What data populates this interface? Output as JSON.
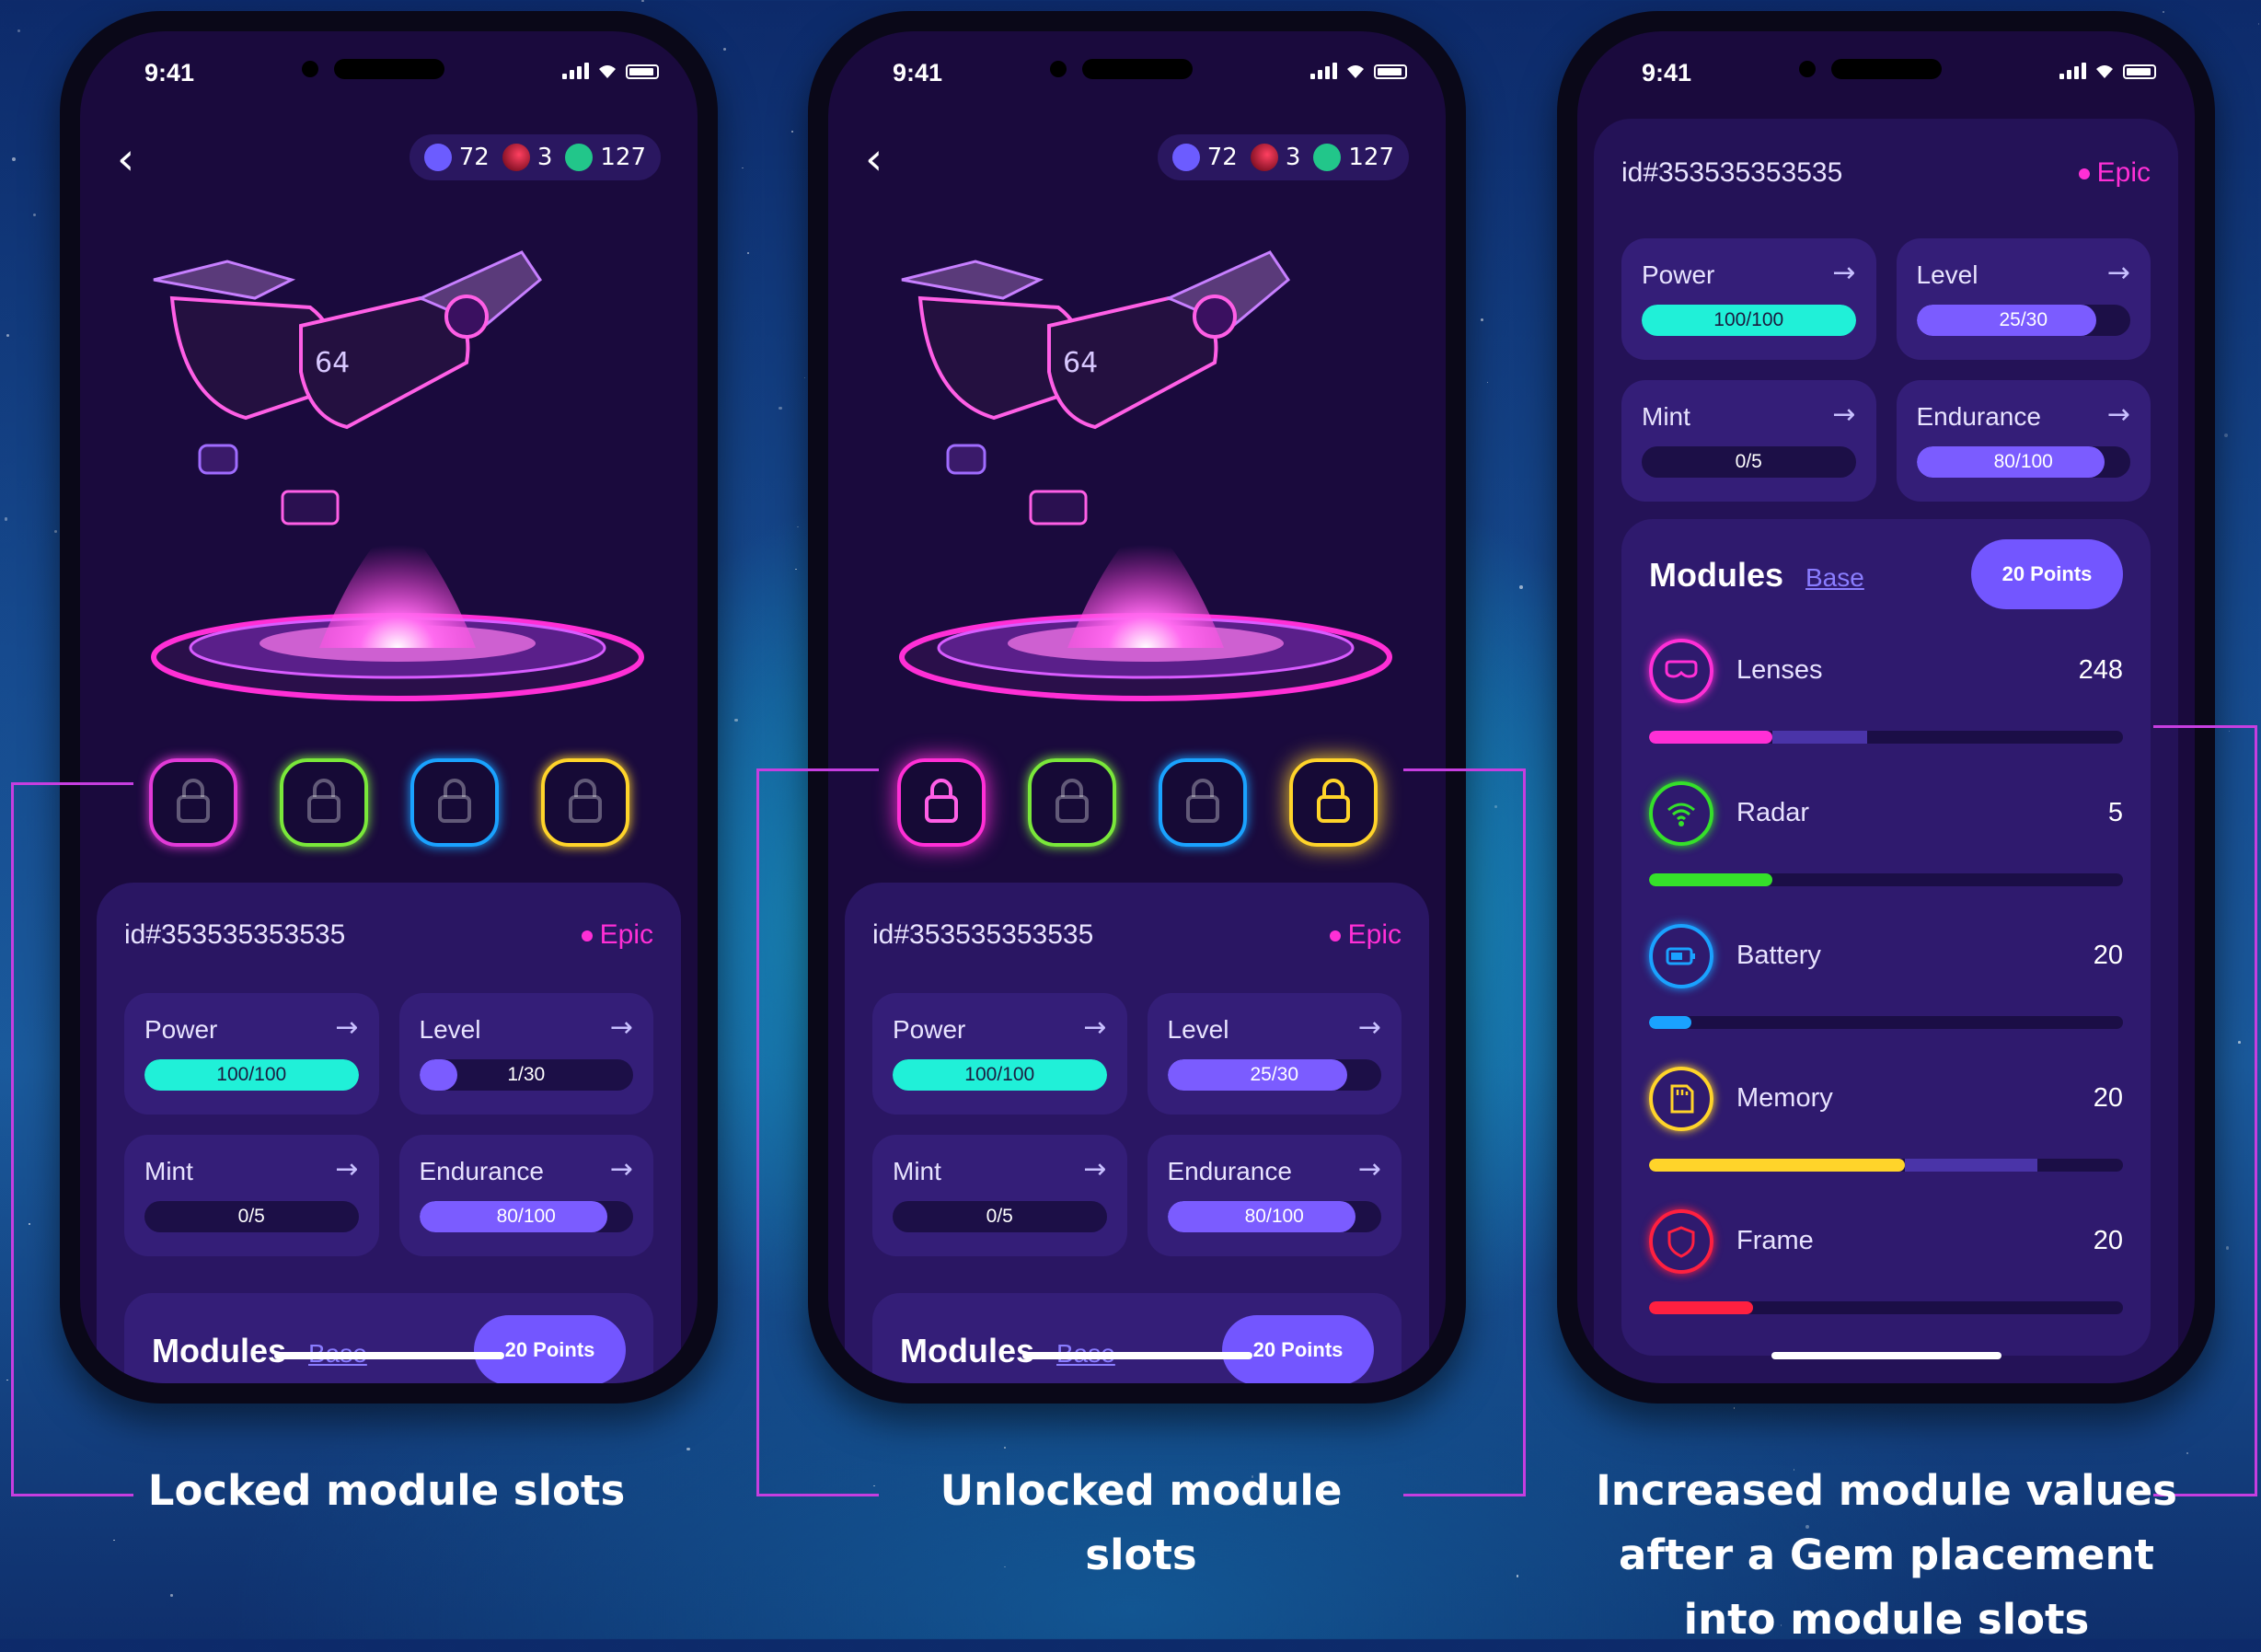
{
  "status": {
    "time": "9:41"
  },
  "currency": [
    {
      "value": "72",
      "color": "#6c5cff"
    },
    {
      "value": "3",
      "color": "#ff2040"
    },
    {
      "value": "127",
      "color": "#22c68a"
    }
  ],
  "card": {
    "id": "id#353535353535",
    "rarity": "Epic"
  },
  "phone1": {
    "stats": [
      {
        "label": "Power",
        "value": "100/100",
        "fill": 1.0,
        "color": "#20f0d8"
      },
      {
        "label": "Level",
        "value": "1/30",
        "fill": 0.18,
        "color": "#7b5cff"
      },
      {
        "label": "Mint",
        "value": "0/5",
        "fill": 0.0,
        "color": "#7b5cff"
      },
      {
        "label": "Endurance",
        "value": "80/100",
        "fill": 0.88,
        "color": "#7b5cff"
      }
    ],
    "slots": [
      {
        "color": "#e23ad8",
        "state": "locked"
      },
      {
        "color": "#7ae83a",
        "state": "locked"
      },
      {
        "color": "#1aa2ff",
        "state": "locked"
      },
      {
        "color": "#ffd42a",
        "state": "locked"
      }
    ]
  },
  "phone2": {
    "stats": [
      {
        "label": "Power",
        "value": "100/100",
        "fill": 1.0,
        "color": "#20f0d8"
      },
      {
        "label": "Level",
        "value": "25/30",
        "fill": 0.84,
        "color": "#7b5cff"
      },
      {
        "label": "Mint",
        "value": "0/5",
        "fill": 0.0,
        "color": "#7b5cff"
      },
      {
        "label": "Endurance",
        "value": "80/100",
        "fill": 0.88,
        "color": "#7b5cff"
      }
    ],
    "slots": [
      {
        "color": "#ff2fd6",
        "state": "unlocked"
      },
      {
        "color": "#7ae83a",
        "state": "locked"
      },
      {
        "color": "#1aa2ff",
        "state": "locked"
      },
      {
        "color": "#ffd42a",
        "state": "unlocked"
      }
    ]
  },
  "phone3": {
    "stats": [
      {
        "label": "Power",
        "value": "100/100",
        "fill": 1.0,
        "color": "#20f0d8"
      },
      {
        "label": "Level",
        "value": "25/30",
        "fill": 0.84,
        "color": "#7b5cff"
      },
      {
        "label": "Mint",
        "value": "0/5",
        "fill": 0.0,
        "color": "#7b5cff"
      },
      {
        "label": "Endurance",
        "value": "80/100",
        "fill": 0.88,
        "color": "#7b5cff"
      }
    ],
    "modules": [
      {
        "name": "Lenses",
        "value": "248",
        "icon": "goggles-icon",
        "color": "#ff2fd6",
        "fill": 0.26,
        "extra": 0.46
      },
      {
        "name": "Radar",
        "value": "5",
        "icon": "wifi-icon",
        "color": "#35e02a",
        "fill": 0.26,
        "extra": 0
      },
      {
        "name": "Battery",
        "value": "20",
        "icon": "battery-icon",
        "color": "#1aa2ff",
        "fill": 0.09,
        "extra": 0
      },
      {
        "name": "Memory",
        "value": "20",
        "icon": "memory-card-icon",
        "color": "#ffd42a",
        "fill": 0.54,
        "extra": 0.82
      },
      {
        "name": "Frame",
        "value": "20",
        "icon": "shield-icon",
        "color": "#ff2040",
        "fill": 0.22,
        "extra": 0
      }
    ]
  },
  "modules_header": {
    "title": "Modules",
    "tab": "Base",
    "points": "20 Points"
  },
  "captions": {
    "locked": "Locked module slots",
    "unlocked": "Unlocked module slots",
    "increased": "Increased module values after a Gem placement into module slots"
  }
}
